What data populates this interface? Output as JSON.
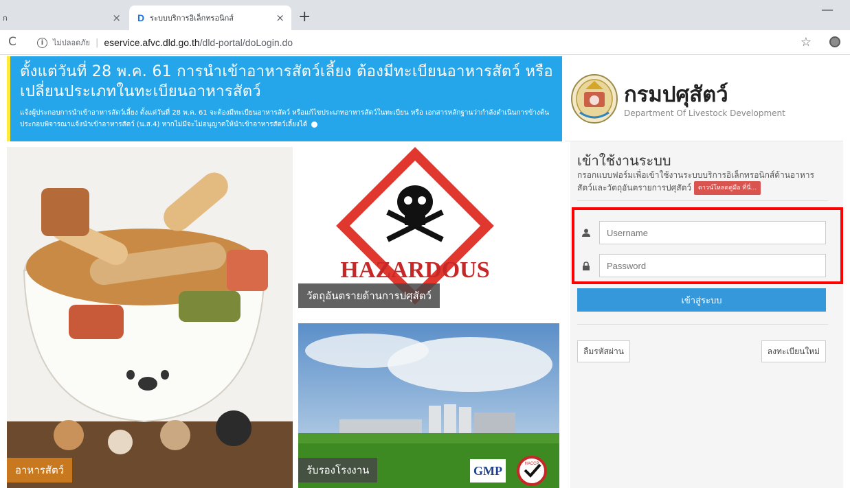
{
  "browser": {
    "prev_tab_label": "ก",
    "active_tab_favicon": "D",
    "active_tab_title": "ระบบบริการอิเล็กทรอนิกส์",
    "close_glyph": "×",
    "new_tab_glyph": "+",
    "minimize_glyph": "—",
    "reload_glyph": "C",
    "security_text": "ไม่ปลอดภัย",
    "url_domain": "eservice.afvc.dld.go.th",
    "url_path": "/dld-portal/doLogin.do",
    "bookmark_glyph": "☆"
  },
  "banner": {
    "title": "ตั้งแต่วันที่ 28 พ.ค. 61 การนำเข้าอาหารสัตว์เลี้ยง ต้องมีทะเบียนอาหารสัตว์ หรือเปลี่ยนประเภทในทะเบียนอาหารสัตว์",
    "text": "แจ้งผู้ประกอบการนำเข้าอาหารสัตว์เลี้ยง ตั้งแต่วันที่ 28 พ.ค. 61 จะต้องมีทะเบียนอาหารสัตว์ หรือแก้ไขประเภทอาหารสัตว์ในทะเบียน หรือ เอกสารหลักฐานว่ากำลังดำเนินการข้างต้น ประกอบพิจารณาแจ้งนำเข้าอาหารสัตว์ (น.ส.4) หากไม่มีจะไม่อนุญาตให้นำเข้าอาหารสัตว์เลี้ยงได้"
  },
  "brand": {
    "name_th": "กรมปศุสัตว์",
    "name_en": "Department Of Livestock Development"
  },
  "tiles": {
    "pet_food_label": "อาหารสัตว์",
    "hazard_label": "วัตถุอันตรายด้านการปศุสัตว์",
    "hazard_sign_text": "HAZARDOUS",
    "factory_label": "รับรองโรงงาน",
    "gmp_text": "GMP",
    "haccp_text": "HACCP"
  },
  "login": {
    "title": "เข้าใช้งานระบบ",
    "description": "กรอกแบบฟอร์มเพื่อเข้าใช้งานระบบบริการอิเล็กทรอนิกส์ด้านอาหารสัตว์และวัตถุอันตรายการปศุสัตว์",
    "download_badge": "ดาวน์โหลดคู่มือ ที่นี่...",
    "username_placeholder": "Username",
    "password_placeholder": "Password",
    "submit_label": "เข้าสู่ระบบ",
    "forgot_label": "ลืมรหัสผ่าน",
    "register_label": "ลงทะเบียนใหม่",
    "highlight_color": "#ff0000",
    "button_color": "#3498db"
  },
  "colors": {
    "banner_bg": "#26a6ea",
    "banner_accent": "#ffeb3b"
  }
}
